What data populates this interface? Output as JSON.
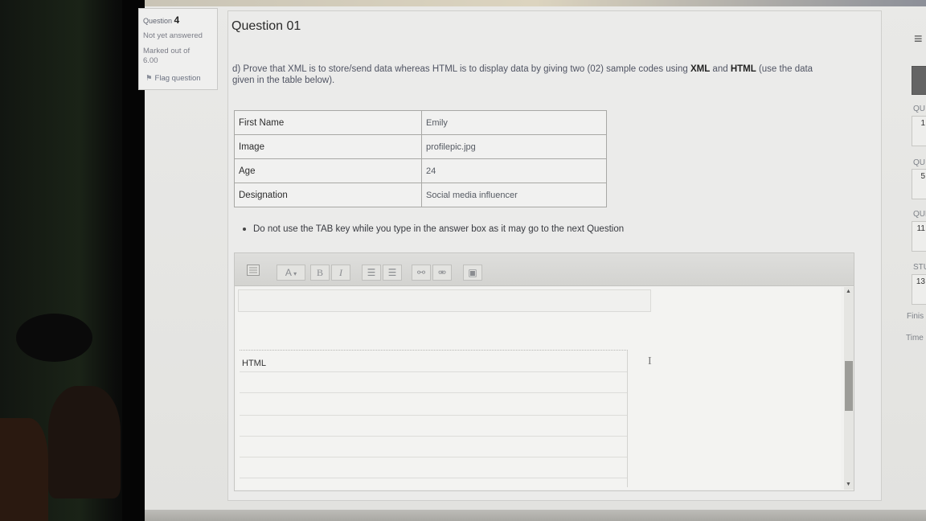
{
  "info": {
    "question_prefix": "Question",
    "question_number": "4",
    "status": "Not yet answered",
    "marked_line1": "Marked out of",
    "marked_line2": "6.00",
    "flag_label": "Flag question",
    "flag_icon": "flag-icon"
  },
  "question": {
    "title": "Question 01",
    "text_part1": "d) Prove that XML is to store/send data whereas HTML is to display data by giving two (02) sample codes using ",
    "text_xml": "XML",
    "text_and": " and ",
    "text_html": "HTML",
    "text_part2": " (use the data",
    "text_line2": "given in the table below).",
    "table": [
      {
        "key": "First Name",
        "value": "Emily"
      },
      {
        "key": "Image",
        "value": "profilepic.jpg"
      },
      {
        "key": "Age",
        "value": "24"
      },
      {
        "key": "Designation",
        "value": "Social media influencer"
      }
    ],
    "note": "Do not use the TAB key while you type in the answer box as it may go to the next Question"
  },
  "editor": {
    "toolbar": {
      "font_size_glyph": "A",
      "bold": "B",
      "italic": "I",
      "unordered_list_glyph": "☰",
      "ordered_list_glyph": "☰",
      "link_glyph": "⚯",
      "unlink_glyph": "⚮",
      "image_glyph": "▣"
    },
    "cursor_glyph": "I",
    "html_label": "HTML"
  },
  "right_nav": {
    "menu_icon": "≡",
    "label_qu1": "QU",
    "num1": "1",
    "label_qu2": "QU",
    "num2": "5",
    "label_qu3": "QUE",
    "num3": "11",
    "label_stu": "STU",
    "num4": "13",
    "finish": "Finis",
    "time": "Time"
  }
}
